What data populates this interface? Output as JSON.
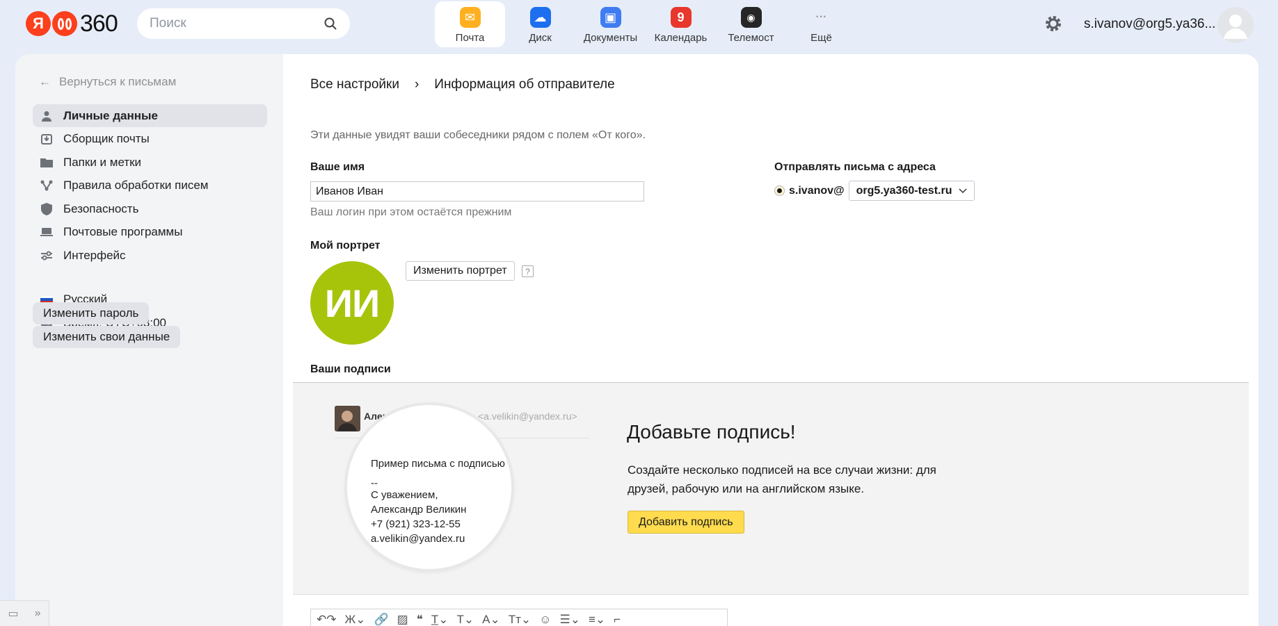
{
  "header": {
    "logo_ya": "Я",
    "logo_num": "360",
    "search_placeholder": "Поиск",
    "apps": [
      {
        "label": "Почта",
        "color": "#ffb020",
        "glyph": "✉"
      },
      {
        "label": "Диск",
        "color": "#1d6ff0",
        "glyph": "☁"
      },
      {
        "label": "Документы",
        "color": "#3f7cf2",
        "glyph": "▣"
      },
      {
        "label": "Календарь",
        "color": "#e8372c",
        "glyph": "9"
      },
      {
        "label": "Телемост",
        "color": "#262626",
        "glyph": "◉"
      },
      {
        "label": "Ещё",
        "color": "transparent",
        "glyph": "···"
      }
    ],
    "user_email": "s.ivanov@org5.ya36..."
  },
  "sidebar": {
    "back_label": "Вернуться к письмам",
    "items": [
      {
        "label": "Личные данные",
        "icon": "person-icon",
        "active": true
      },
      {
        "label": "Сборщик почты",
        "icon": "inbox-download-icon"
      },
      {
        "label": "Папки и метки",
        "icon": "folder-icon"
      },
      {
        "label": "Правила обработки писем",
        "icon": "filter-rules-icon"
      },
      {
        "label": "Безопасность",
        "icon": "shield-icon"
      },
      {
        "label": "Почтовые программы",
        "icon": "laptop-icon"
      },
      {
        "label": "Интерфейс",
        "icon": "sliders-icon"
      }
    ],
    "language": "Русский",
    "timezone": "Время: UTC+03:00",
    "change_password": "Изменить пароль",
    "change_data": "Изменить свои данные"
  },
  "main": {
    "breadcrumb_root": "Все настройки",
    "breadcrumb_sep": "›",
    "breadcrumb_current": "Информация об отправителе",
    "hint": "Эти данные увидят ваши собеседники рядом с полем «От кого».",
    "name_label": "Ваше имя",
    "name_value": "Иванов Иван",
    "name_sub": "Ваш логин при этом остаётся прежним",
    "from_label": "Отправлять письма с адреса",
    "from_login": "s.ivanov@",
    "from_domain": "org5.ya360-test.ru",
    "portrait_label": "Мой портрет",
    "portrait_initials": "ИИ",
    "change_portrait": "Изменить портрет",
    "help": "?",
    "signatures_label": "Ваши подписи"
  },
  "signature_promo": {
    "demo_name": "Александр Великин",
    "demo_email": "<a.velikin@yandex.ru>",
    "demo_lines": [
      "Пример письма с подписью",
      "--",
      "С уважением,",
      "Александр Великин",
      "+7 (921) 323-12-55",
      "a.velikin@yandex.ru"
    ],
    "title": "Добавьте подпись!",
    "text": "Создайте несколько подписей на все случаи жизни: для друзей, рабочую или на английском языке.",
    "button": "Добавить подпись"
  },
  "toolbar": {
    "items": [
      "↶↷",
      "Ж⌄",
      "🔗",
      "▨",
      "❝",
      "T̲⌄",
      "T⌄",
      "A⌄",
      "Tт⌄",
      "☺",
      "☰⌄",
      "≡⌄",
      "⌐"
    ]
  }
}
